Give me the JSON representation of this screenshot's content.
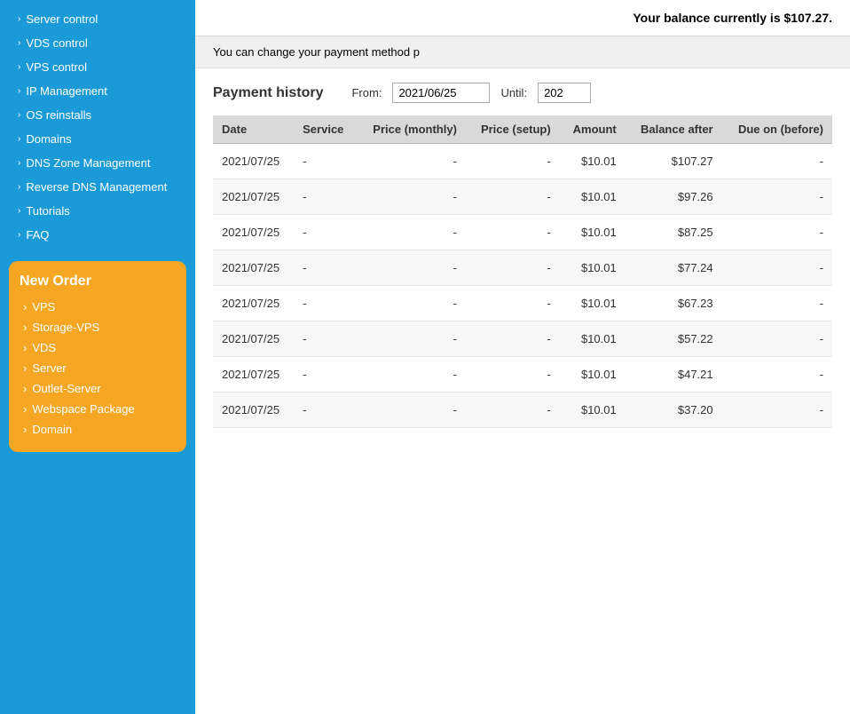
{
  "sidebar": {
    "items": [
      {
        "label": "Server control",
        "icon": "chevron-right"
      },
      {
        "label": "VDS control",
        "icon": "chevron-right"
      },
      {
        "label": "VPS control",
        "icon": "chevron-right"
      },
      {
        "label": "IP Management",
        "icon": "chevron-right"
      },
      {
        "label": "OS reinstalls",
        "icon": "chevron-right"
      },
      {
        "label": "Domains",
        "icon": "chevron-right"
      },
      {
        "label": "DNS Zone Management",
        "icon": "chevron-right"
      },
      {
        "label": "Reverse DNS Management",
        "icon": "chevron-right"
      },
      {
        "label": "Tutorials",
        "icon": "chevron-right"
      },
      {
        "label": "FAQ",
        "icon": "chevron-right"
      }
    ]
  },
  "new_order": {
    "title": "New Order",
    "items": [
      {
        "label": "VPS"
      },
      {
        "label": "Storage-VPS"
      },
      {
        "label": "VDS"
      },
      {
        "label": "Server"
      },
      {
        "label": "Outlet-Server"
      },
      {
        "label": "Webspace Package"
      },
      {
        "label": "Domain"
      }
    ]
  },
  "balance_bar": {
    "text": "Your balance currently is $107.27."
  },
  "payment_method_bar": {
    "text": "You can change your payment method p"
  },
  "payment_history": {
    "title": "Payment history",
    "from_label": "From:",
    "from_value": "2021/06/25",
    "until_label": "Until:",
    "until_value": "202",
    "table": {
      "columns": [
        {
          "key": "date",
          "label": "Date"
        },
        {
          "key": "service",
          "label": "Service"
        },
        {
          "key": "price_monthly",
          "label": "Price (monthly)"
        },
        {
          "key": "price_setup",
          "label": "Price (setup)"
        },
        {
          "key": "amount",
          "label": "Amount"
        },
        {
          "key": "balance_after",
          "label": "Balance after"
        },
        {
          "key": "due_on_before",
          "label": "Due on (before)"
        }
      ],
      "rows": [
        {
          "date": "2021/07/25",
          "service": "-",
          "price_monthly": "-",
          "price_setup": "-",
          "amount": "$10.01",
          "balance_after": "$107.27",
          "due_on_before": "-"
        },
        {
          "date": "2021/07/25",
          "service": "-",
          "price_monthly": "-",
          "price_setup": "-",
          "amount": "$10.01",
          "balance_after": "$97.26",
          "due_on_before": "-"
        },
        {
          "date": "2021/07/25",
          "service": "-",
          "price_monthly": "-",
          "price_setup": "-",
          "amount": "$10.01",
          "balance_after": "$87.25",
          "due_on_before": "-"
        },
        {
          "date": "2021/07/25",
          "service": "-",
          "price_monthly": "-",
          "price_setup": "-",
          "amount": "$10.01",
          "balance_after": "$77.24",
          "due_on_before": "-"
        },
        {
          "date": "2021/07/25",
          "service": "-",
          "price_monthly": "-",
          "price_setup": "-",
          "amount": "$10.01",
          "balance_after": "$67.23",
          "due_on_before": "-"
        },
        {
          "date": "2021/07/25",
          "service": "-",
          "price_monthly": "-",
          "price_setup": "-",
          "amount": "$10.01",
          "balance_after": "$57.22",
          "due_on_before": "-"
        },
        {
          "date": "2021/07/25",
          "service": "-",
          "price_monthly": "-",
          "price_setup": "-",
          "amount": "$10.01",
          "balance_after": "$47.21",
          "due_on_before": "-"
        },
        {
          "date": "2021/07/25",
          "service": "-",
          "price_monthly": "-",
          "price_setup": "-",
          "amount": "$10.01",
          "balance_after": "$37.20",
          "due_on_before": "-"
        }
      ]
    }
  }
}
